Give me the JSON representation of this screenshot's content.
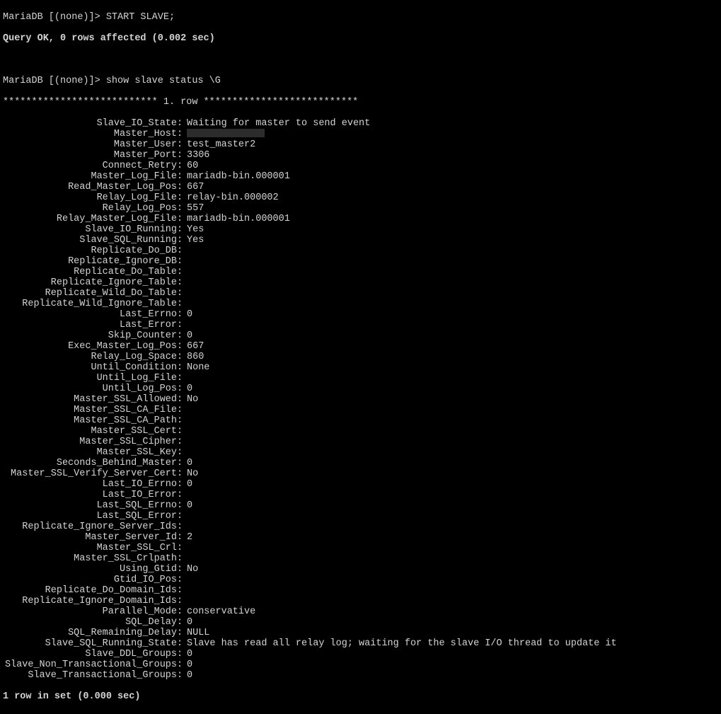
{
  "prompt1": "MariaDB [(none)]> ",
  "cmd1": "START SLAVE;",
  "result1": "Query OK, 0 rows affected (0.002 sec)",
  "prompt2": "MariaDB [(none)]> ",
  "cmd2": "show slave status \\G",
  "row_header": "*************************** 1. row ***************************",
  "status": [
    {
      "label": "Slave_IO_State",
      "value": "Waiting for master to send event"
    },
    {
      "label": "Master_Host",
      "value": "",
      "redacted": true
    },
    {
      "label": "Master_User",
      "value": "test_master2"
    },
    {
      "label": "Master_Port",
      "value": "3306"
    },
    {
      "label": "Connect_Retry",
      "value": "60"
    },
    {
      "label": "Master_Log_File",
      "value": "mariadb-bin.000001"
    },
    {
      "label": "Read_Master_Log_Pos",
      "value": "667"
    },
    {
      "label": "Relay_Log_File",
      "value": "relay-bin.000002"
    },
    {
      "label": "Relay_Log_Pos",
      "value": "557"
    },
    {
      "label": "Relay_Master_Log_File",
      "value": "mariadb-bin.000001"
    },
    {
      "label": "Slave_IO_Running",
      "value": "Yes"
    },
    {
      "label": "Slave_SQL_Running",
      "value": "Yes"
    },
    {
      "label": "Replicate_Do_DB",
      "value": ""
    },
    {
      "label": "Replicate_Ignore_DB",
      "value": ""
    },
    {
      "label": "Replicate_Do_Table",
      "value": ""
    },
    {
      "label": "Replicate_Ignore_Table",
      "value": ""
    },
    {
      "label": "Replicate_Wild_Do_Table",
      "value": ""
    },
    {
      "label": "Replicate_Wild_Ignore_Table",
      "value": ""
    },
    {
      "label": "Last_Errno",
      "value": "0"
    },
    {
      "label": "Last_Error",
      "value": ""
    },
    {
      "label": "Skip_Counter",
      "value": "0"
    },
    {
      "label": "Exec_Master_Log_Pos",
      "value": "667"
    },
    {
      "label": "Relay_Log_Space",
      "value": "860"
    },
    {
      "label": "Until_Condition",
      "value": "None"
    },
    {
      "label": "Until_Log_File",
      "value": ""
    },
    {
      "label": "Until_Log_Pos",
      "value": "0"
    },
    {
      "label": "Master_SSL_Allowed",
      "value": "No"
    },
    {
      "label": "Master_SSL_CA_File",
      "value": ""
    },
    {
      "label": "Master_SSL_CA_Path",
      "value": ""
    },
    {
      "label": "Master_SSL_Cert",
      "value": ""
    },
    {
      "label": "Master_SSL_Cipher",
      "value": ""
    },
    {
      "label": "Master_SSL_Key",
      "value": ""
    },
    {
      "label": "Seconds_Behind_Master",
      "value": "0"
    },
    {
      "label": "Master_SSL_Verify_Server_Cert",
      "value": "No"
    },
    {
      "label": "Last_IO_Errno",
      "value": "0"
    },
    {
      "label": "Last_IO_Error",
      "value": ""
    },
    {
      "label": "Last_SQL_Errno",
      "value": "0"
    },
    {
      "label": "Last_SQL_Error",
      "value": ""
    },
    {
      "label": "Replicate_Ignore_Server_Ids",
      "value": ""
    },
    {
      "label": "Master_Server_Id",
      "value": "2"
    },
    {
      "label": "Master_SSL_Crl",
      "value": ""
    },
    {
      "label": "Master_SSL_Crlpath",
      "value": ""
    },
    {
      "label": "Using_Gtid",
      "value": "No"
    },
    {
      "label": "Gtid_IO_Pos",
      "value": ""
    },
    {
      "label": "Replicate_Do_Domain_Ids",
      "value": ""
    },
    {
      "label": "Replicate_Ignore_Domain_Ids",
      "value": ""
    },
    {
      "label": "Parallel_Mode",
      "value": "conservative"
    },
    {
      "label": "SQL_Delay",
      "value": "0"
    },
    {
      "label": "SQL_Remaining_Delay",
      "value": "NULL"
    },
    {
      "label": "Slave_SQL_Running_State",
      "value": "Slave has read all relay log; waiting for the slave I/O thread to update it"
    },
    {
      "label": "Slave_DDL_Groups",
      "value": "0"
    },
    {
      "label": "Slave_Non_Transactional_Groups",
      "value": "0"
    },
    {
      "label": "Slave_Transactional_Groups",
      "value": "0"
    }
  ],
  "footer": "1 row in set (0.000 sec)"
}
